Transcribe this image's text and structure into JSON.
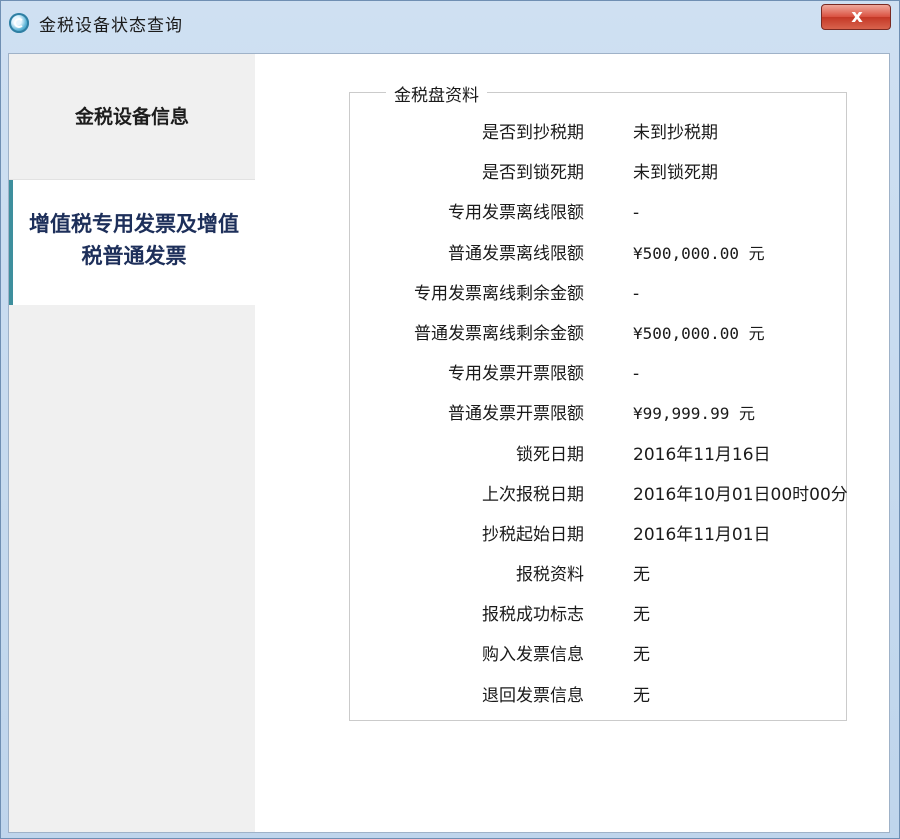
{
  "window": {
    "title": "金税设备状态查询",
    "close_label": "x"
  },
  "sidebar": {
    "items": [
      {
        "label": "金税设备信息"
      },
      {
        "label": "增值税专用发票及增值税普通发票"
      }
    ]
  },
  "group": {
    "title": "金税盘资料",
    "rows": [
      {
        "label": "是否到抄税期",
        "value": "未到抄税期"
      },
      {
        "label": "是否到锁死期",
        "value": "未到锁死期"
      },
      {
        "label": "专用发票离线限额",
        "value": "-"
      },
      {
        "label": "普通发票离线限额",
        "value": "¥500,000.00 元"
      },
      {
        "label": "专用发票离线剩余金额",
        "value": "-"
      },
      {
        "label": "普通发票离线剩余金额",
        "value": "¥500,000.00 元"
      },
      {
        "label": "专用发票开票限额",
        "value": "-"
      },
      {
        "label": "普通发票开票限额",
        "value": "¥99,999.99 元"
      },
      {
        "label": "锁死日期",
        "value": "2016年11月16日"
      },
      {
        "label": "上次报税日期",
        "value": "2016年10月01日00时00分"
      },
      {
        "label": "抄税起始日期",
        "value": "2016年11月01日"
      },
      {
        "label": "报税资料",
        "value": "无"
      },
      {
        "label": "报税成功标志",
        "value": "无"
      },
      {
        "label": "购入发票信息",
        "value": "无"
      },
      {
        "label": "退回发票信息",
        "value": "无"
      }
    ]
  }
}
